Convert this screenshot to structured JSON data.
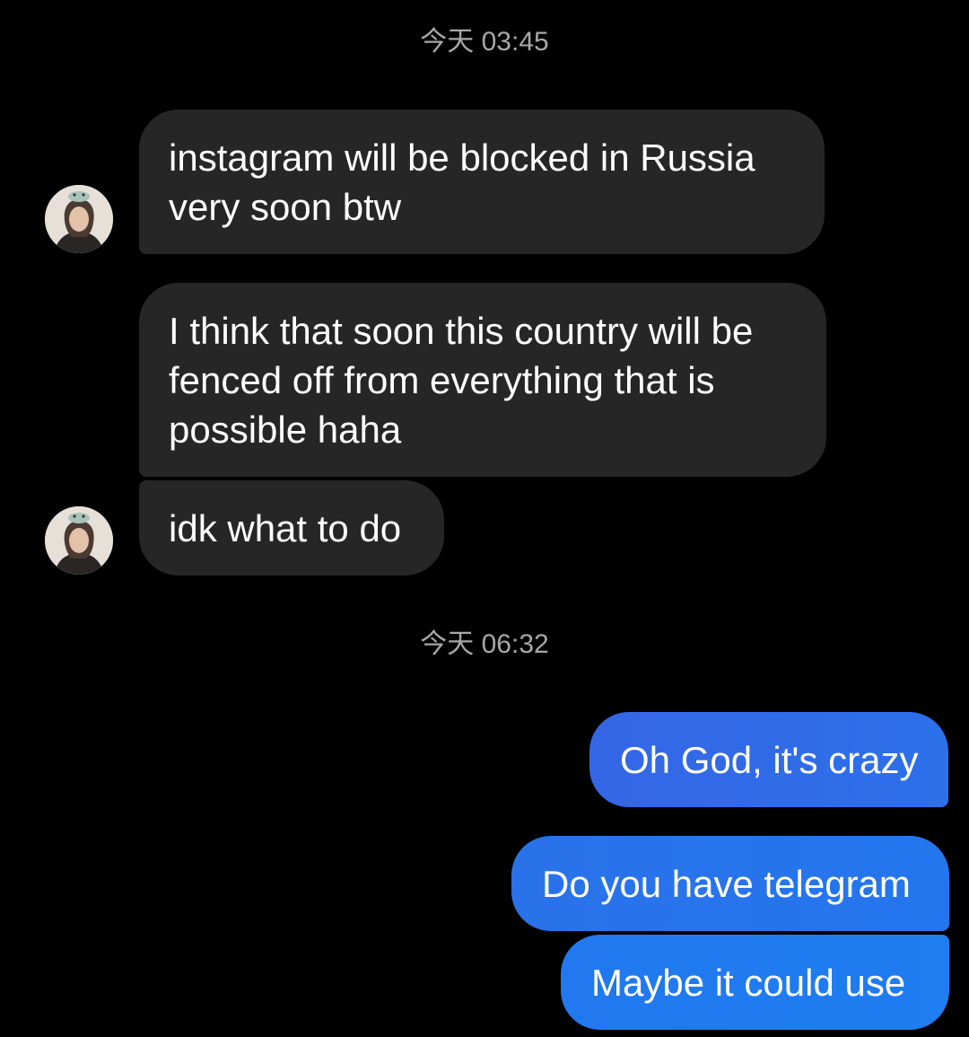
{
  "thread": {
    "timestamps": [
      "今天 03:45",
      "今天 06:32"
    ],
    "received": [
      {
        "lines": [
          "instagram will be blocked in Russia",
          "very soon btw"
        ]
      },
      {
        "lines": [
          "I think that soon this country will be",
          "fenced off from everything that is",
          "possible haha"
        ]
      },
      {
        "lines": [
          "idk what to do"
        ]
      }
    ],
    "sent": [
      {
        "text": "Oh God, it's crazy"
      },
      {
        "text": "Do you have telegram"
      },
      {
        "text": "Maybe it could use"
      }
    ]
  },
  "colors": {
    "background": "#000000",
    "received_bubble": "#262626",
    "sent_gradient": [
      "#3864e3",
      "#1f7ef0"
    ],
    "timestamp": "#a8a8a8"
  },
  "icons": {
    "avatar": "contact-avatar-photo"
  }
}
